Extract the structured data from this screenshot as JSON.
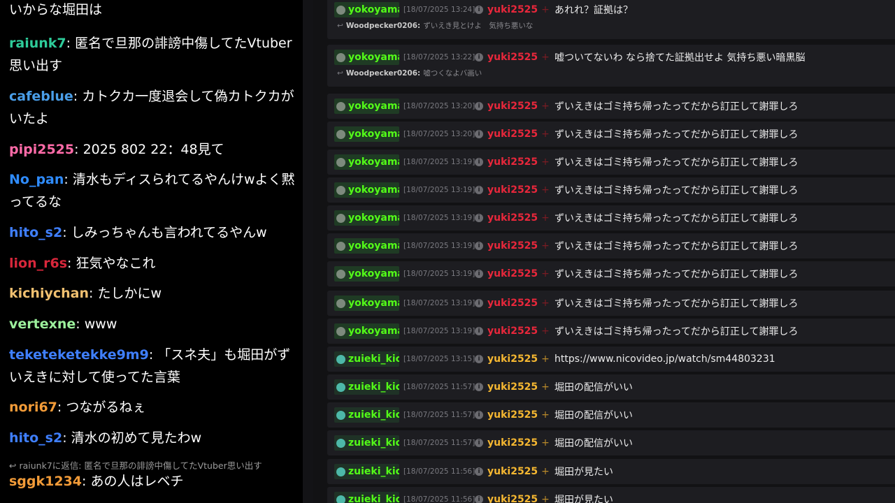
{
  "chat": {
    "messages": [
      {
        "user": "",
        "color": "#ffffff",
        "text": "いからな堀田は"
      },
      {
        "user": "raiunk7",
        "color": "#2ecc9a",
        "text": "匿名で旦那の誹謗中傷してたVtuber思い出す"
      },
      {
        "user": "cafeblue",
        "color": "#4a9ee8",
        "text": "カトクカ一度退会して偽カトクカがいたよ"
      },
      {
        "user": "pipi2525",
        "color": "#ff6ba8",
        "text": "2025 802 22：48見て"
      },
      {
        "user": "No_pan",
        "color": "#2f8cff",
        "text": "清水もディスられてるやんけwよく黙ってるな"
      },
      {
        "user": "hito_s2",
        "color": "#3f7fff",
        "text": "しみっちゃんも言われてるやんw"
      },
      {
        "user": "lion_r6s",
        "color": "#d8273b",
        "text": "狂気やなこれ"
      },
      {
        "user": "kichiychan",
        "color": "#f0c070",
        "text": "たしかにw"
      },
      {
        "user": "vertexne",
        "color": "#9cf09c",
        "text": "www"
      },
      {
        "user": "teketeketekke9m9",
        "color": "#3f7fff",
        "text": "「スネ夫」も堀田がずいえきに対して使ってた言葉"
      },
      {
        "user": "nori67",
        "color": "#f29b38",
        "text": "つながるねぇ"
      },
      {
        "user": "hito_s2",
        "color": "#3f7fff",
        "text": "清水の初めて見たわw"
      },
      {
        "user": "sggk1234",
        "color": "#f29b38",
        "text": "あの人はレベチ"
      }
    ],
    "reply": {
      "glyph": "↩",
      "text": "raiunk7に返信: 匿名で旦那の誹謗中傷してたVtuber思い出す"
    }
  },
  "log": {
    "rows": [
      {
        "author": "yokoyamai",
        "icon": "gray",
        "time": "[18/07/2025 13:24]",
        "target": "yuki2525",
        "tcolor": "red",
        "text": "あれれ？証拠は？",
        "reply_user": "Woodpecker0206:",
        "reply_text": "ずいえき見とけよ　気持ち悪いな"
      },
      {
        "author": "yokoyamai",
        "icon": "gray",
        "time": "[18/07/2025 13:22]",
        "target": "yuki2525",
        "tcolor": "red",
        "text": "嘘ついてないわ なら捨てた証拠出せよ 気持ち悪い暗黒脳",
        "reply_user": "Woodpecker0206:",
        "reply_text": "嘘つくなよバ画い"
      },
      {
        "author": "yokoyamai",
        "icon": "gray",
        "time": "[18/07/2025 13:20]",
        "target": "yuki2525",
        "tcolor": "red",
        "text": "ずいえきはゴミ持ち帰ったってだから訂正して謝罪しろ"
      },
      {
        "author": "yokoyamai",
        "icon": "gray",
        "time": "[18/07/2025 13:20]",
        "target": "yuki2525",
        "tcolor": "red",
        "text": "ずいえきはゴミ持ち帰ったってだから訂正して謝罪しろ"
      },
      {
        "author": "yokoyamai",
        "icon": "gray",
        "time": "[18/07/2025 13:19]",
        "target": "yuki2525",
        "tcolor": "red",
        "text": "ずいえきはゴミ持ち帰ったってだから訂正して謝罪しろ"
      },
      {
        "author": "yokoyamai",
        "icon": "gray",
        "time": "[18/07/2025 13:19]",
        "target": "yuki2525",
        "tcolor": "red",
        "text": "ずいえきはゴミ持ち帰ったってだから訂正して謝罪しろ"
      },
      {
        "author": "yokoyamai",
        "icon": "gray",
        "time": "[18/07/2025 13:19]",
        "target": "yuki2525",
        "tcolor": "red",
        "text": "ずいえきはゴミ持ち帰ったってだから訂正して謝罪しろ"
      },
      {
        "author": "yokoyamai",
        "icon": "gray",
        "time": "[18/07/2025 13:19]",
        "target": "yuki2525",
        "tcolor": "red",
        "text": "ずいえきはゴミ持ち帰ったってだから訂正して謝罪しろ"
      },
      {
        "author": "yokoyamai",
        "icon": "gray",
        "time": "[18/07/2025 13:19]",
        "target": "yuki2525",
        "tcolor": "red",
        "text": "ずいえきはゴミ持ち帰ったってだから訂正して謝罪しろ"
      },
      {
        "author": "yokoyamai",
        "icon": "gray",
        "time": "[18/07/2025 13:19]",
        "target": "yuki2525",
        "tcolor": "red",
        "text": "ずいえきはゴミ持ち帰ったってだから訂正して謝罪しろ"
      },
      {
        "author": "yokoyamai",
        "icon": "gray",
        "time": "[18/07/2025 13:19]",
        "target": "yuki2525",
        "tcolor": "red",
        "text": "ずいえきはゴミ持ち帰ったってだから訂正して謝罪しろ"
      },
      {
        "author": "zuieki_kick",
        "icon": "globe",
        "time": "[18/07/2025 13:15]",
        "target": "yuki2525",
        "tcolor": "gold",
        "text": "https://www.nicovideo.jp/watch/sm44803231"
      },
      {
        "author": "zuieki_kick",
        "icon": "globe",
        "time": "[18/07/2025 11:57]",
        "target": "yuki2525",
        "tcolor": "gold",
        "text": "堀田の配信がいい"
      },
      {
        "author": "zuieki_kick",
        "icon": "globe",
        "time": "[18/07/2025 11:57]",
        "target": "yuki2525",
        "tcolor": "gold",
        "text": "堀田の配信がいい"
      },
      {
        "author": "zuieki_kick",
        "icon": "globe",
        "time": "[18/07/2025 11:57]",
        "target": "yuki2525",
        "tcolor": "gold",
        "text": "堀田の配信がいい"
      },
      {
        "author": "zuieki_kick",
        "icon": "globe",
        "time": "[18/07/2025 11:56]",
        "target": "yuki2525",
        "tcolor": "gold",
        "text": "堀田が見たい"
      },
      {
        "author": "zuieki_kick",
        "icon": "globe",
        "time": "[18/07/2025 11:56]",
        "target": "yuki2525",
        "tcolor": "gold",
        "text": "堀田が見たい"
      }
    ],
    "plus_glyph": "+",
    "info_glyph": "i",
    "reply_glyph": "↩"
  }
}
